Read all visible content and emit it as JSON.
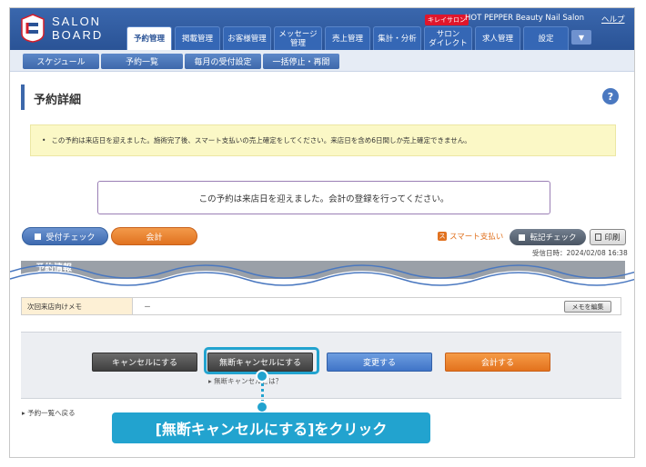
{
  "header": {
    "logo_line1": "SALON",
    "logo_line2": "BOARD",
    "badge": "キレイサロン",
    "brand_name": "HOT PEPPER Beauty Nail Salon",
    "help": "ヘルプ",
    "tabs": [
      {
        "label": "予約管理",
        "active": true
      },
      {
        "label": "掲載管理",
        "active": false
      },
      {
        "label": "お客様管理",
        "active": false
      },
      {
        "label": "メッセージ\n管理",
        "active": false
      },
      {
        "label": "売上管理",
        "active": false
      },
      {
        "label": "集計・分析",
        "active": false
      },
      {
        "label": "サロン\nダイレクト",
        "active": false
      },
      {
        "label": "求人管理",
        "active": false
      },
      {
        "label": "設定",
        "active": false
      }
    ],
    "menu_icon": "triangle-down-icon"
  },
  "subnav": {
    "items": [
      "スケジュール",
      "予約一覧",
      "毎月の受付設定",
      "一括停止・再開"
    ]
  },
  "page": {
    "title": "予約詳細",
    "help_glyph": "?",
    "notice": "この予約は来店日を迎えました。施術完了後、スマート支払いの売上確定をしてください。来店日を含め6日間しか売上確定できません。",
    "message": "この予約は来店日を迎えました。会計の登録を行ってください。"
  },
  "actions": {
    "uketsuke": "受付チェック",
    "kaikei": "会計",
    "smart_pay": "スマート支払い",
    "smart_pay_glyph": "ス",
    "tenki": "転記チェック",
    "print": "印刷",
    "received": "受信日時：2024/02/08 16:38"
  },
  "section": {
    "title": "予約情報"
  },
  "memo": {
    "label": "次回来店向けメモ",
    "value": "－",
    "edit": "メモを編集"
  },
  "buttons": {
    "cancel": "キャンセルにする",
    "mudan_cancel": "無断キャンセルにする",
    "change": "変更する",
    "checkout": "会計する",
    "mudan_link": "無断キャンセルとは？"
  },
  "back_link": "予約一覧へ戻る",
  "callout": "[無断キャンセルにする]をクリック",
  "colors": {
    "header": "#2a5396",
    "accent_orange": "#e17220",
    "callout": "#22a3cf"
  }
}
